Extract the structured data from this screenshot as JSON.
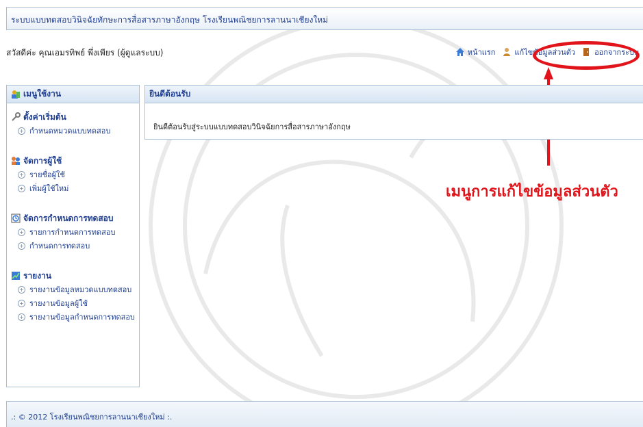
{
  "header": {
    "title": "ระบบแบบทดสอบวินิจฉัยทักษะการสื่อสารภาษาอังกฤษ โรงเรียนพณิชยการลานนาเชียงใหม่"
  },
  "user_bar": {
    "greeting": "สวัสดีค่ะ คุณเอมรทิพย์ พึ่งเพียร (ผู้ดูแลระบบ)",
    "links": {
      "home": "หน้าแรก",
      "edit_profile": "แก้ไขข้อมูลส่วนตัว",
      "logout": "ออกจากระบบ"
    }
  },
  "callout": {
    "text": "เมนูการแก้ไขข้อมูลส่วนตัว"
  },
  "sidebar": {
    "title": "เมนูใช้งาน",
    "sections": [
      {
        "title": "ตั้งค่าเริ่มต้น",
        "icon": "wrench-icon",
        "items": [
          "กำหนดหมวดแบบทดสอบ"
        ]
      },
      {
        "title": "จัดการผู้ใช้",
        "icon": "users-icon",
        "items": [
          "รายชื่อผู้ใช้",
          "เพิ่มผู้ใช้ใหม่"
        ]
      },
      {
        "title": "จัดการกำหนดการทดสอบ",
        "icon": "clock-icon",
        "items": [
          "รายการกำหนดการทดสอบ",
          "กำหนดการทดสอบ"
        ]
      },
      {
        "title": "รายงาน",
        "icon": "chart-icon",
        "items": [
          "รายงานข้อมูลหมวดแบบทดสอบ",
          "รายงานข้อมูลผู้ใช้",
          "รายงานข้อมูลกำหนดการทดสอบ"
        ]
      }
    ]
  },
  "main": {
    "panel_title": "ยินดีต้อนรับ",
    "welcome_text": "ยินดีต้อนรับสู่ระบบแบบทดสอบวินิจฉัยการสื่อสารภาษาอังกฤษ"
  },
  "footer": {
    "text": ".: © 2012 โรงเรียนพณิชยการลานนาเชียงใหม่ :."
  },
  "colors": {
    "accent": "#1f3e8f",
    "border": "#a9bfd6",
    "callout": "#e1141b"
  }
}
